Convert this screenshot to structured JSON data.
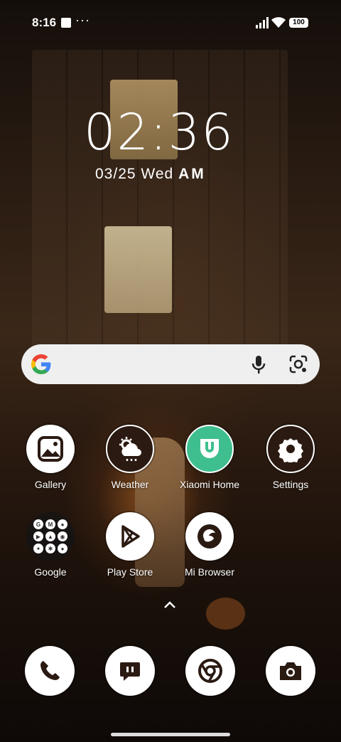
{
  "status": {
    "time": "8:16",
    "more_dots": "···",
    "battery": "100"
  },
  "lockscreen": {
    "clock": "02:36",
    "date": "03/25",
    "weekday": "Wed",
    "ampm": "AM"
  },
  "search_widget": {
    "icons": [
      "google-logo",
      "mic-icon",
      "lens-icon"
    ]
  },
  "apps_row1": [
    {
      "label": "Gallery",
      "icon": "gallery-icon"
    },
    {
      "label": "Weather",
      "icon": "weather-icon"
    },
    {
      "label": "Xiaomi Home",
      "icon": "xiaomi-home-icon"
    },
    {
      "label": "Settings",
      "icon": "settings-icon"
    }
  ],
  "apps_row2": [
    {
      "label": "Google",
      "icon": "google-folder"
    },
    {
      "label": "Play Store",
      "icon": "play-store-icon"
    },
    {
      "label": "Mi Browser",
      "icon": "mi-browser-icon"
    }
  ],
  "dock": [
    {
      "icon": "phone-icon"
    },
    {
      "icon": "messages-icon"
    },
    {
      "icon": "chrome-icon"
    },
    {
      "icon": "camera-icon"
    }
  ],
  "colors": {
    "search_bg": "#efefef",
    "icon_bg": "#ffffff",
    "xiaomi_home_bg": "#3fbf8f"
  }
}
